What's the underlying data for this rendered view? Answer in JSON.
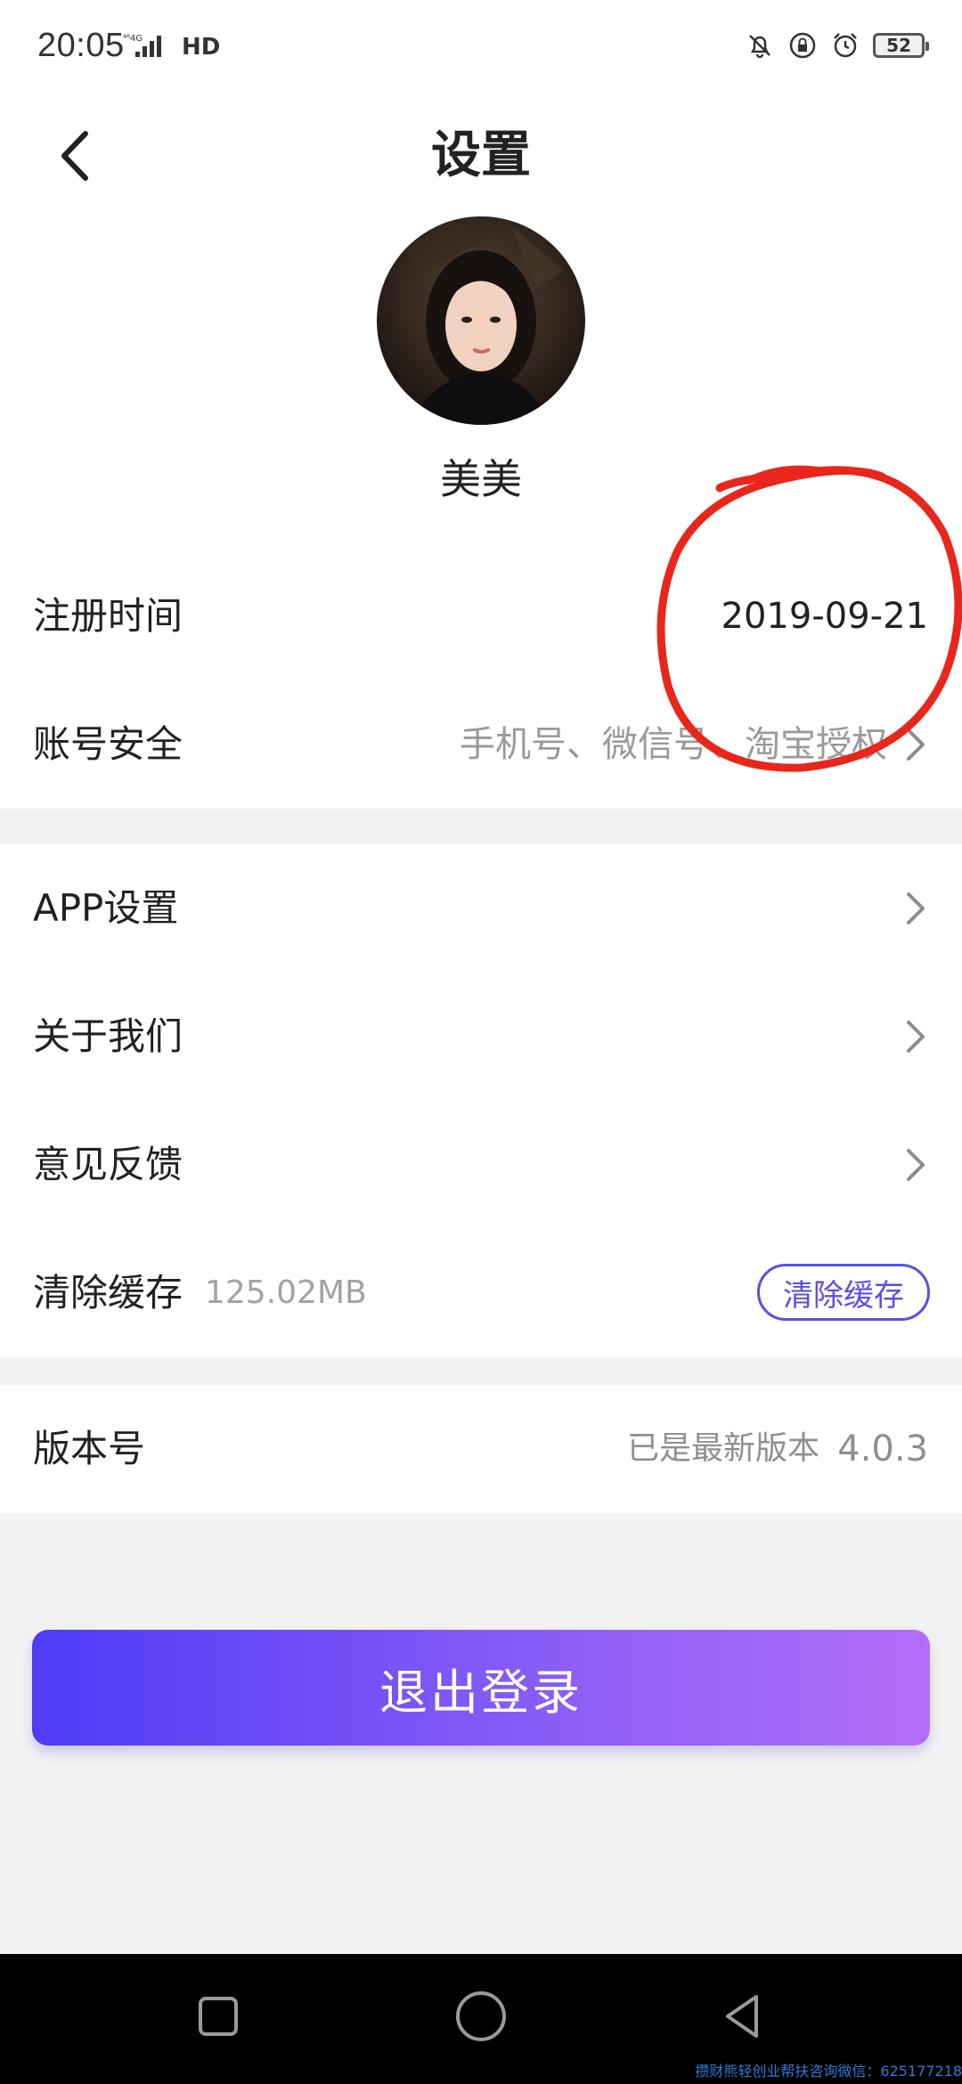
{
  "status_bar": {
    "time": "20:05",
    "signal": "⁴⁶⁴ᴳ.ıl",
    "hd": "HD",
    "battery": "52"
  },
  "header": {
    "title": "设置"
  },
  "profile": {
    "username": "美美"
  },
  "account": {
    "register_label": "注册时间",
    "register_date": "2019-09-21",
    "security_label": "账号安全",
    "security_value": "手机号、微信号、淘宝授权"
  },
  "settings": {
    "app_settings_label": "APP设置",
    "about_label": "关于我们",
    "feedback_label": "意见反馈",
    "clear_cache_label": "清除缓存",
    "cache_size": "125.02MB",
    "clear_cache_button": "清除缓存"
  },
  "version": {
    "label": "版本号",
    "note": "已是最新版本",
    "number": "4.0.3"
  },
  "logout": {
    "label": "退出登录"
  },
  "watermark": {
    "text": "攒财熊轻创业帮扶咨询微信：625177218"
  },
  "colors": {
    "accent": "#5c4ee6",
    "gradient_start": "#4f3bf5",
    "gradient_end": "#b46ef9",
    "annotation": "#e8261c"
  }
}
